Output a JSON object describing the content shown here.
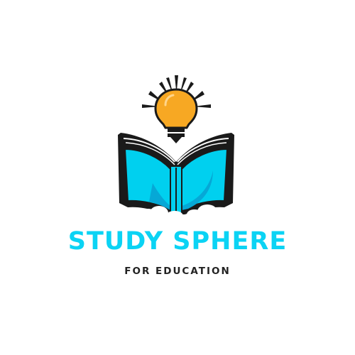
{
  "logo": {
    "brand_name": "STUDY SPHERE",
    "tagline": "FOR EDUCATION",
    "icons": [
      "lightbulb-icon",
      "open-book-icon",
      "cloud-icon"
    ]
  },
  "colors": {
    "brand_cyan": "#0bd3f4",
    "book_cyan": "#00d0ef",
    "book_shadow": "#06a8d6",
    "bulb_orange": "#f7a823",
    "outline_dark": "#1a1a1a",
    "tagline_dark": "#222222",
    "background": "#ffffff"
  }
}
